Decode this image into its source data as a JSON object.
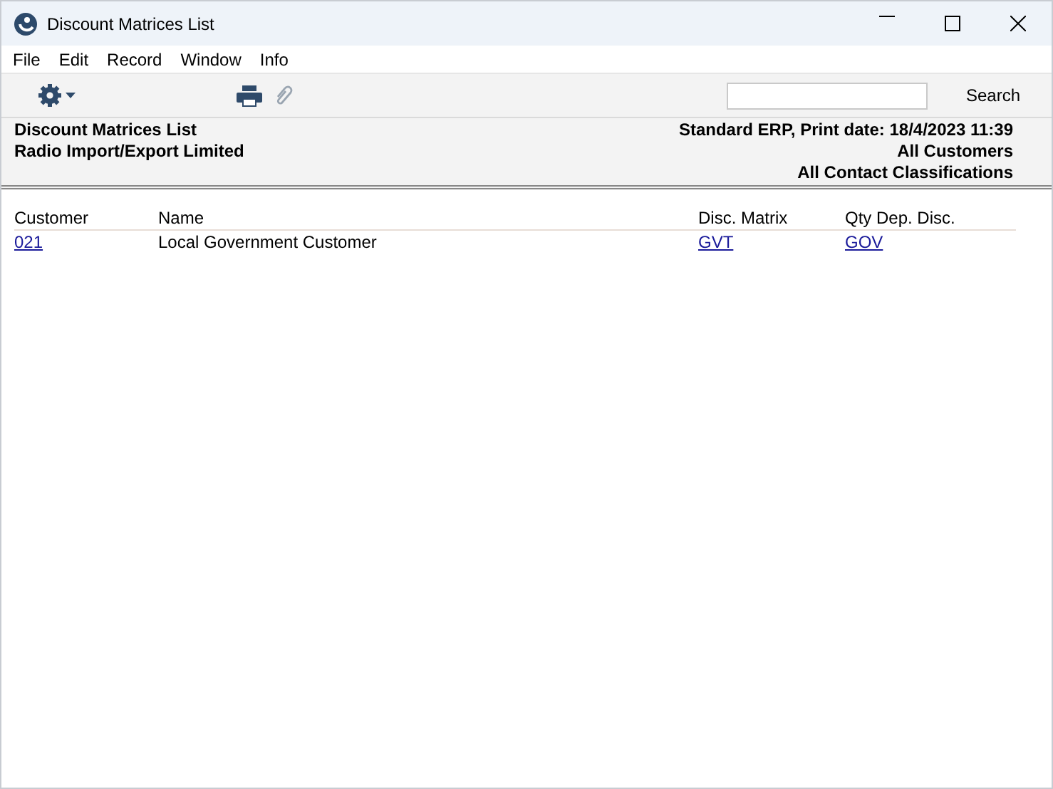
{
  "window": {
    "title": "Discount Matrices List"
  },
  "menu": [
    "File",
    "Edit",
    "Record",
    "Window",
    "Info"
  ],
  "search": {
    "button": "Search"
  },
  "report_header": {
    "left": [
      "Discount Matrices List",
      "Radio Import/Export Limited"
    ],
    "right": [
      "Standard ERP, Print date: 18/4/2023 11:39",
      "All Customers",
      "All Contact Classifications"
    ]
  },
  "table": {
    "columns": [
      "Customer",
      "Name",
      "Disc. Matrix",
      "Qty Dep. Disc."
    ],
    "rows": [
      [
        {
          "text": "021",
          "link": true
        },
        {
          "text": "Local Government Customer",
          "link": false
        },
        {
          "text": "GVT",
          "link": true
        },
        {
          "text": "GOV",
          "link": true
        }
      ]
    ]
  }
}
